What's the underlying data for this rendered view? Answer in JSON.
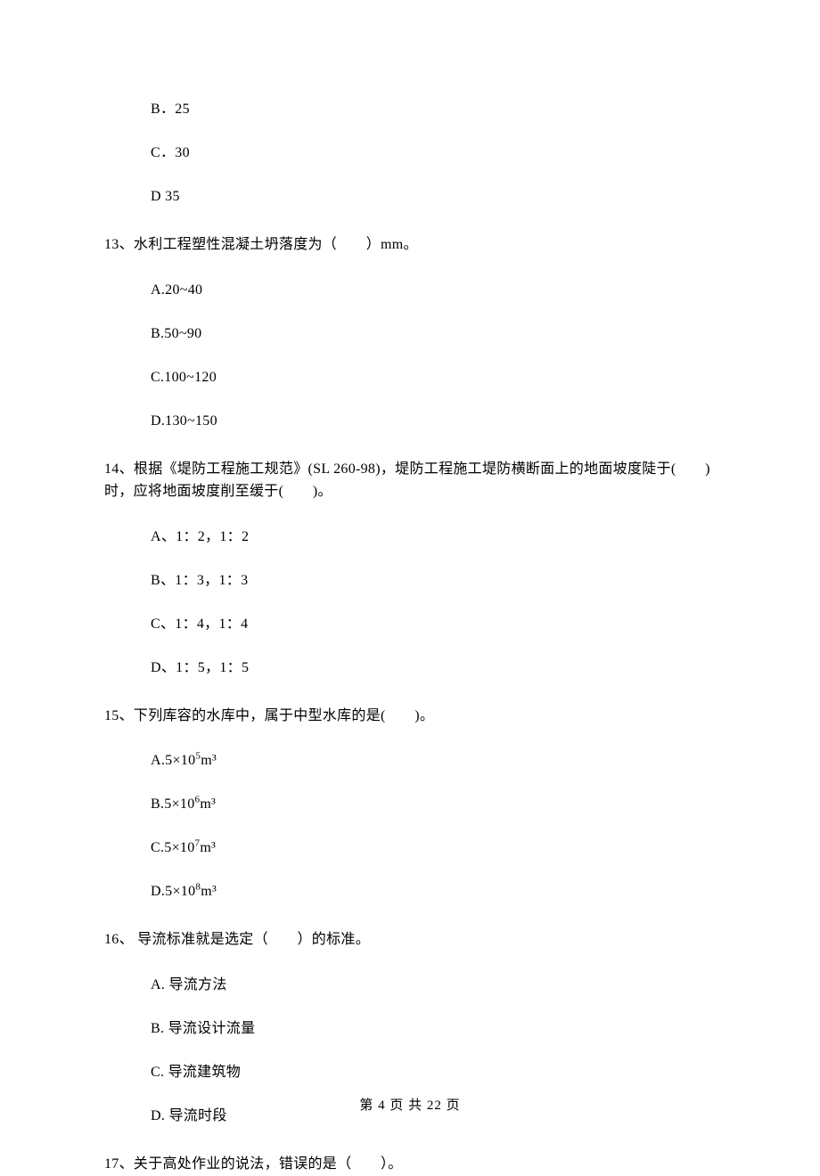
{
  "q12_continuation": {
    "options": [
      "B．25",
      "C．30",
      "D   35"
    ]
  },
  "q13": {
    "text": "13、水利工程塑性混凝土坍落度为（　　）mm。",
    "options": [
      "A.20~40",
      "B.50~90",
      "C.100~120",
      "D.130~150"
    ]
  },
  "q14": {
    "text": "14、根据《堤防工程施工规范》(SL 260-98)，堤防工程施工堤防横断面上的地面坡度陡于(　　)时，应将地面坡度削至缓于(　　)。",
    "options": [
      "A、1：2，1：2",
      "B、1：3，1：3",
      "C、1：4，1：4",
      "D、1：5，1：5"
    ]
  },
  "q15": {
    "text": "15、下列库容的水库中，属于中型水库的是(　　)。",
    "options": [
      {
        "prefix": "A.5×10",
        "sup": "5",
        "suffix": "m³"
      },
      {
        "prefix": "B.5×10",
        "sup": "6",
        "suffix": "m³"
      },
      {
        "prefix": "C.5×10",
        "sup": "7",
        "suffix": "m³"
      },
      {
        "prefix": "D.5×10",
        "sup": "8",
        "suffix": "m³"
      }
    ]
  },
  "q16": {
    "text": "16、 导流标准就是选定（　　）的标准。",
    "options": [
      "A.  导流方法",
      "B.  导流设计流量",
      "C.  导流建筑物",
      "D.  导流时段"
    ]
  },
  "q17": {
    "text": "17、关于高处作业的说法，错误的是（　　）。"
  },
  "footer": "第 4 页 共 22 页"
}
